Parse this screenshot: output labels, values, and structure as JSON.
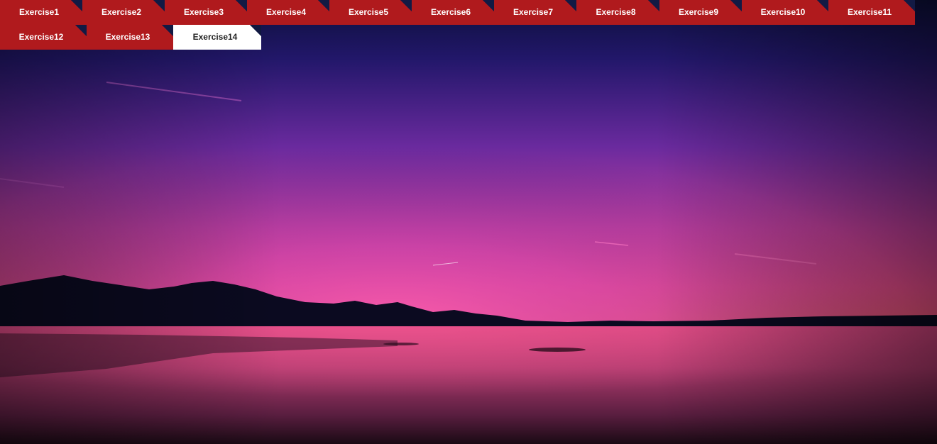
{
  "nav": {
    "tabs": [
      {
        "label": "Exercise1",
        "active": false
      },
      {
        "label": "Exercise2",
        "active": false
      },
      {
        "label": "Exercise3",
        "active": false
      },
      {
        "label": "Exercise4",
        "active": false
      },
      {
        "label": "Exercise5",
        "active": false
      },
      {
        "label": "Exercise6",
        "active": false
      },
      {
        "label": "Exercise7",
        "active": false
      },
      {
        "label": "Exercise8",
        "active": false
      },
      {
        "label": "Exercise9",
        "active": false
      },
      {
        "label": "Exercise10",
        "active": false
      },
      {
        "label": "Exercise11",
        "active": false
      },
      {
        "label": "Exercise12",
        "active": false
      },
      {
        "label": "Exercise13",
        "active": false
      },
      {
        "label": "Exercise14",
        "active": true
      }
    ]
  },
  "colors": {
    "tab_background": "#b01a1d",
    "tab_active_background": "#ffffff",
    "tab_text": "#ffffff",
    "tab_active_text": "#222222"
  },
  "background": {
    "scene": "sunset-lake-mountains"
  }
}
